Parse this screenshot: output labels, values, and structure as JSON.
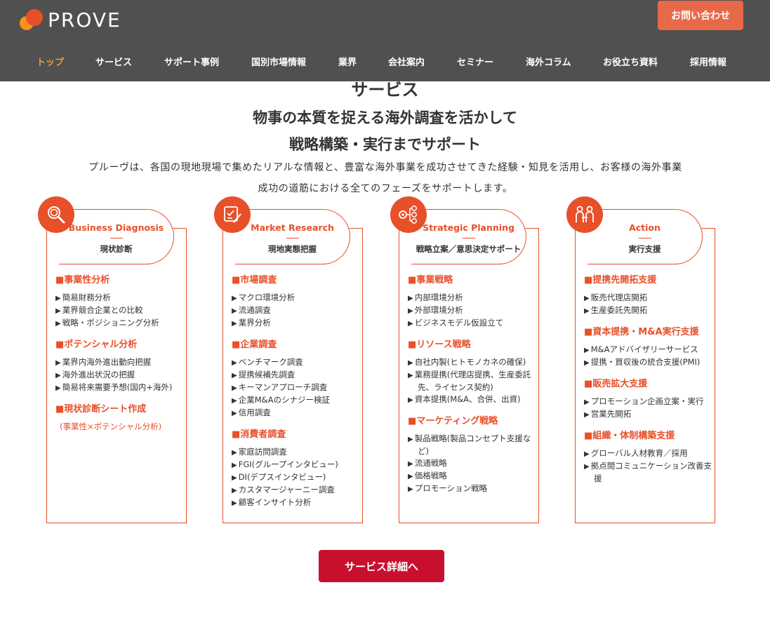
{
  "header": {
    "logo_text": "PROVE",
    "contact_label": "お問い合わせ",
    "nav": [
      {
        "label": "トップ",
        "active": true
      },
      {
        "label": "サービス"
      },
      {
        "label": "サポート事例"
      },
      {
        "label": "国別市場情報"
      },
      {
        "label": "業界"
      },
      {
        "label": "会社案内"
      },
      {
        "label": "セミナー"
      },
      {
        "label": "海外コラム"
      },
      {
        "label": "お役立ち資料"
      },
      {
        "label": "採用情報"
      }
    ]
  },
  "section": {
    "title": "サービス",
    "lead_line1": "物事の本質を捉える海外調査を活かして",
    "lead_line2": "戦略構築・実行までサポート",
    "description_line1": "プルーヴは、各国の現地現場で集めたリアルな情報と、豊富な海外事業を成功させてきた経験・知見を活用し、お客様の海外事業",
    "description_line2": "成功の道筋における全てのフェーズをサポートします。"
  },
  "cards": [
    {
      "icon": "magnifier-icon",
      "title_en": "Business Diagnosis",
      "title_jp": "現状診断",
      "groups": [
        {
          "title": "■事業性分析",
          "items": [
            "簡易財務分析",
            "業界競合企業との比較",
            "戦略・ポジショニング分析"
          ]
        },
        {
          "title": "■ポテンシャル分析",
          "items": [
            "業界内海外進出動向把握",
            "海外進出状況の把握",
            "簡易将来需要予想(国内+海外)"
          ]
        },
        {
          "title": "■現状診断シート作成",
          "items": [],
          "note": "(事業性×ポテンシャル分析)"
        }
      ]
    },
    {
      "icon": "checklist-pen-icon",
      "title_en": "Market Research",
      "title_jp": "現地実態把握",
      "groups": [
        {
          "title": "■市場調査",
          "items": [
            "マクロ環境分析",
            "流通調査",
            "業界分析"
          ]
        },
        {
          "title": "■企業調査",
          "items": [
            "ベンチマーク調査",
            "提携候補先調査",
            "キーマンアプローチ調査",
            "企業M&Aのシナジー検証",
            "信用調査"
          ]
        },
        {
          "title": "■消費者調査",
          "items": [
            "家庭訪問調査",
            "FGI(グループインタビュー)",
            "DI(デプスインタビュー)",
            "カスタマージャーニー調査",
            "顧客インサイト分析"
          ]
        }
      ]
    },
    {
      "icon": "strategy-flow-icon",
      "title_en": "Strategic Planning",
      "title_jp": "戦略立案／意思決定サポート",
      "groups": [
        {
          "title": "■事業戦略",
          "items": [
            "内部環境分析",
            "外部環境分析",
            "ビジネスモデル仮設立て"
          ]
        },
        {
          "title": "■リソース戦略",
          "items": [
            "自社内製(ヒトモノカネの確保)",
            "業務提携(代理店提携、生産委託先、ライセンス契約)",
            "資本提携(M&A、合併、出資)"
          ]
        },
        {
          "title": "■マーケティング戦略",
          "items": [
            "製品戦略(製品コンセプト支援など)",
            "流通戦略",
            "価格戦略",
            "プロモーション戦略"
          ]
        }
      ]
    },
    {
      "icon": "handshake-people-icon",
      "title_en": "Action",
      "title_jp": "実行支援",
      "groups": [
        {
          "title": "■提携先開拓支援",
          "items": [
            "販売代理店開拓",
            "生産委託先開拓"
          ]
        },
        {
          "title": "■資本提携・M&A実行支援",
          "items": [
            "M&Aアドバイザリーサービス",
            "提携・買収後の統合支援(PMI)"
          ]
        },
        {
          "title": "■販売拡大支援",
          "items": [
            "プロモーション企画立案・実行",
            "営業先開拓"
          ]
        },
        {
          "title": "■組織・体制構築支援",
          "items": [
            "グローバル人材教育／採用",
            "拠点間コミュニケーション改善支援"
          ]
        }
      ]
    }
  ],
  "cta": {
    "label": "サービス詳細へ"
  }
}
